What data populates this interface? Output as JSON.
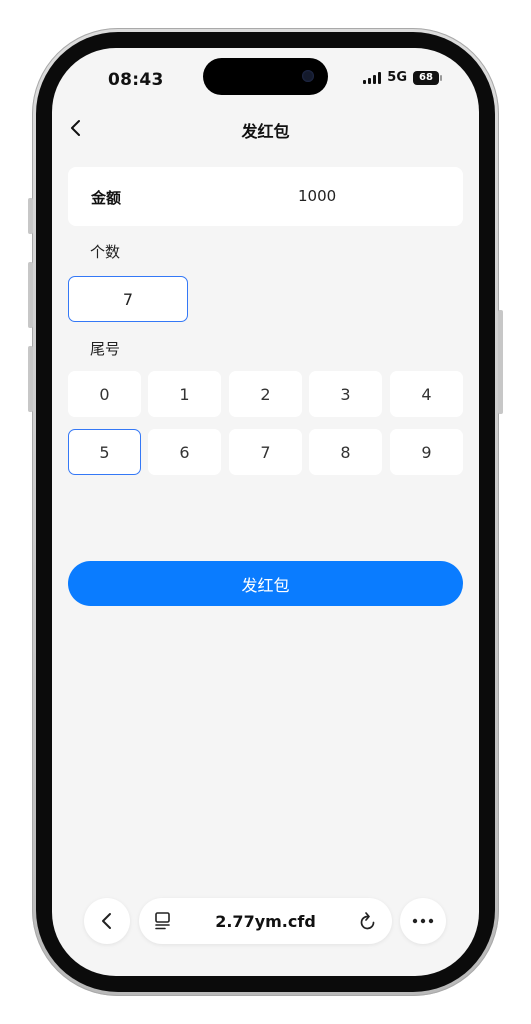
{
  "status_bar": {
    "time": "08:43",
    "network": "5G",
    "battery": "68"
  },
  "nav": {
    "title": "发红包",
    "back_icon": "chevron-left-icon"
  },
  "form": {
    "amount_label": "金额",
    "amount_value": "1000",
    "count_label": "个数",
    "count_value": "7",
    "tail_label": "尾号",
    "tail_digits": [
      "0",
      "1",
      "2",
      "3",
      "4",
      "5",
      "6",
      "7",
      "8",
      "9"
    ],
    "selected_digit": "5"
  },
  "primary_button": {
    "label": "发红包",
    "color": "#0a7cff"
  },
  "browser": {
    "url": "2.77ym.cfd",
    "icons": [
      "chevron-left-icon",
      "page-icon",
      "reload-icon",
      "more-icon"
    ]
  },
  "colors": {
    "accent": "#3478f6",
    "background": "#f5f5f5"
  }
}
